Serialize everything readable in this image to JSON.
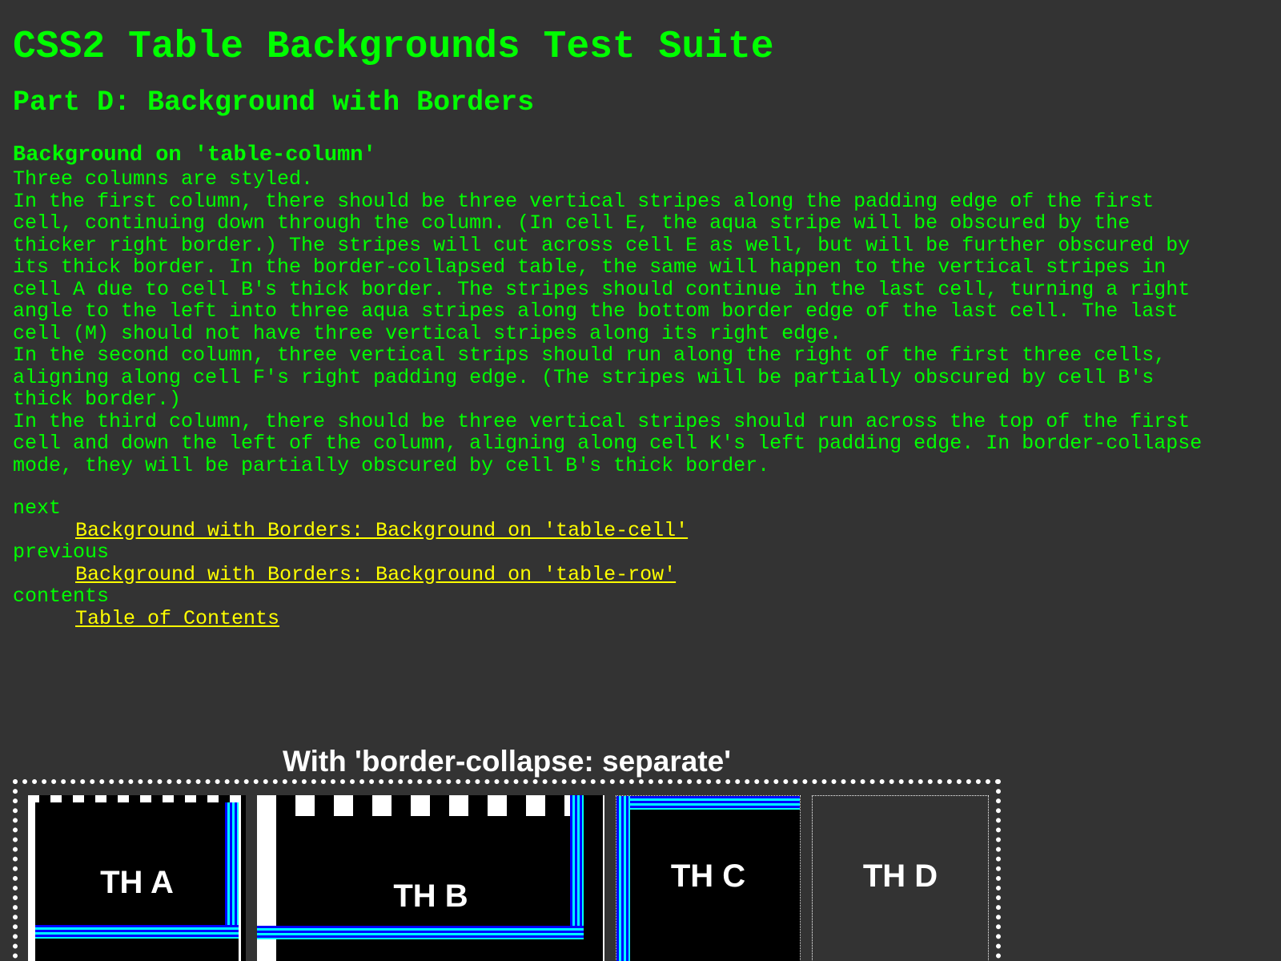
{
  "page": {
    "title": "CSS2 Table Backgrounds Test Suite",
    "part": "Part D: Background with Borders",
    "section": "Background on 'table-column'",
    "paragraphs": [
      "Three columns are styled.",
      [
        "In the first column, there should be three vertical stripes along the padding edge of the first",
        "cell, continuing down through the column. (In cell E, the aqua stripe will be obscured by the",
        "thicker right border.) The stripes will cut across cell E as well, but will be further obscured by",
        "its thick border. In the border-collapsed table, the same will happen to the vertical stripes in",
        "cell A due to cell B's thick border. The stripes should continue in the last cell, turning a right",
        "angle to the left into three aqua stripes along the bottom border edge of the last cell. The last",
        "cell (M) should not have three vertical stripes along its right edge."
      ],
      [
        "In the second column, three vertical strips should run along the right of the first three cells,",
        "aligning along cell F's right padding edge. (The stripes will be partially obscured by cell B's",
        "thick border.)"
      ],
      [
        "In the third column, there should be three vertical stripes should run across the top of the first",
        "cell and down the left of the column, aligning along cell K's left padding edge. In border-collapse",
        "mode, they will be partially obscured by cell B's thick border."
      ]
    ]
  },
  "nav": {
    "next_label": "next",
    "next_link": "Background with Borders: Background on 'table-cell'",
    "previous_label": "previous",
    "previous_link": "Background with Borders: Background on 'table-row'",
    "contents_label": "contents",
    "contents_link": "Table of Contents"
  },
  "test_table": {
    "caption": "With 'border-collapse: separate'",
    "cells": [
      "TH A",
      "TH B",
      "TH C",
      "TH D"
    ]
  },
  "colors": {
    "page_background": "#333333",
    "text": "#00ff00",
    "link": "#ffff00",
    "caption": "#ffffff",
    "stripe_blue": "#0000ff",
    "stripe_aqua": "#00ffff"
  }
}
